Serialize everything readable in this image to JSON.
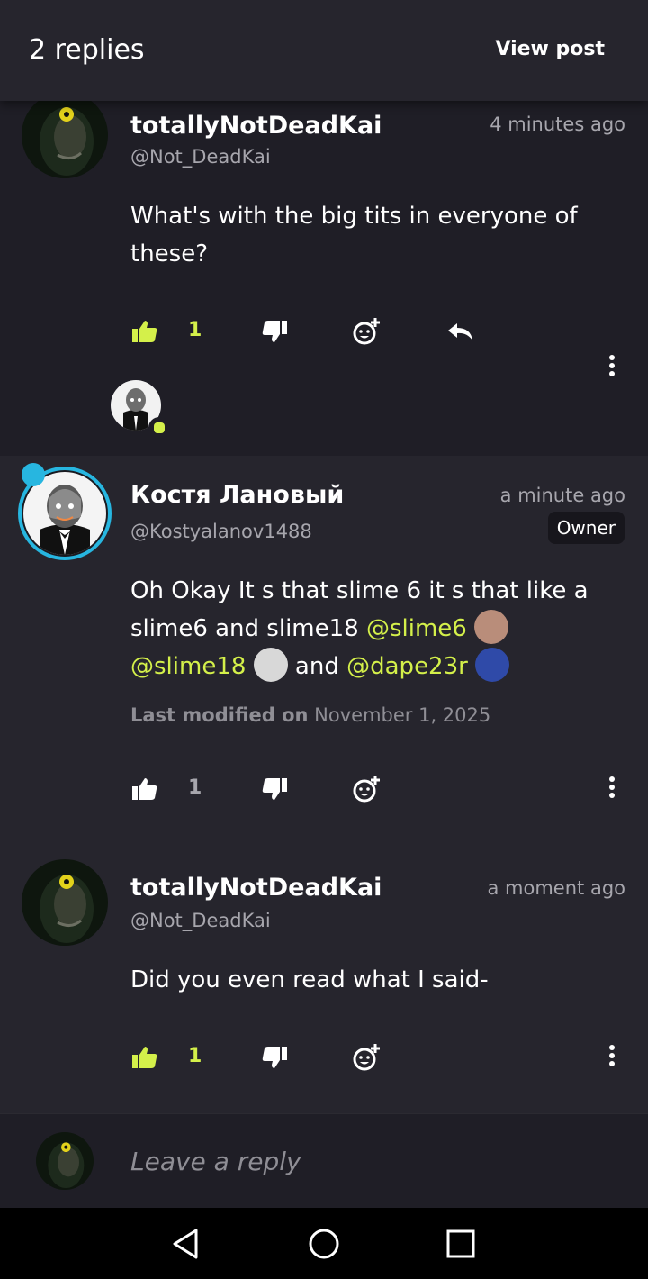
{
  "header": {
    "title": "2 replies",
    "view_post": "View post"
  },
  "comments": [
    {
      "name": "totallyNotDeadKai",
      "handle": "@Not_DeadKai",
      "time": "4 minutes ago",
      "text": "What's with the big tits in everyone of these?",
      "likes": "1",
      "liked": true
    },
    {
      "name": "Костя Лановый",
      "handle": "@Kostyalanov1488",
      "time": "a minute ago",
      "badge": "Owner",
      "text_part1": "Oh Okay It s that slime 6 it s that like a slime6 and slime18 ",
      "mention1": "@slime6",
      "mention2": "@slime18",
      "text_part2": " and ",
      "mention3": "@dape23r",
      "modified_label": "Last modified on",
      "modified_date": "November 1, 2025",
      "likes": "1",
      "liked": false
    },
    {
      "name": "totallyNotDeadKai",
      "handle": "@Not_DeadKai",
      "time": "a moment ago",
      "text": "Did you even read what I said-",
      "likes": "1",
      "liked": true
    }
  ],
  "reply_bar": {
    "placeholder": "Leave a reply"
  },
  "colors": {
    "accent": "#d4f04a",
    "background": "#1f1e26",
    "panel": "#26252d",
    "muted": "#a7a6ad"
  },
  "icons": [
    "thumbs-up-icon",
    "thumbs-down-icon",
    "add-reaction-icon",
    "reply-icon",
    "more-vertical-icon",
    "back-icon",
    "home-icon",
    "recents-icon"
  ]
}
